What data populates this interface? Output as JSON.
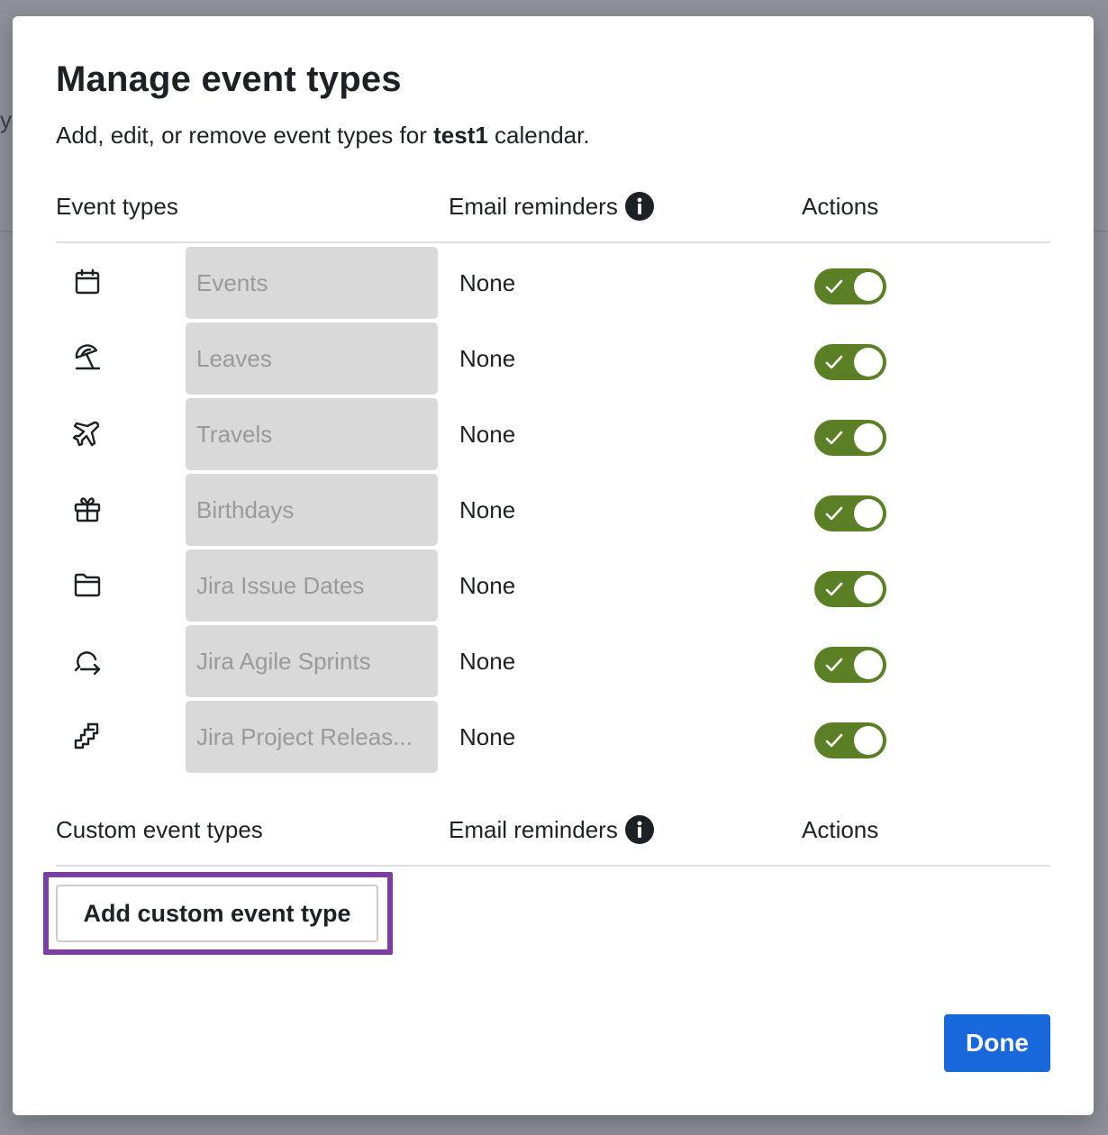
{
  "backdrop": {
    "edge_char": "y"
  },
  "dialog": {
    "title": "Manage event types",
    "subtitle_prefix": "Add, edit, or remove event types for ",
    "calendar_name": "test1",
    "subtitle_suffix": " calendar."
  },
  "builtin_section": {
    "header_types": "Event types",
    "header_reminders": "Email reminders",
    "header_actions": "Actions",
    "rows": [
      {
        "icon": "calendar-icon",
        "name": "Events",
        "reminder": "None",
        "enabled": true
      },
      {
        "icon": "beach-umbrella-icon",
        "name": "Leaves",
        "reminder": "None",
        "enabled": true
      },
      {
        "icon": "airplane-icon",
        "name": "Travels",
        "reminder": "None",
        "enabled": true
      },
      {
        "icon": "gift-icon",
        "name": "Birthdays",
        "reminder": "None",
        "enabled": true
      },
      {
        "icon": "folder-icon",
        "name": "Jira Issue Dates",
        "reminder": "None",
        "enabled": true
      },
      {
        "icon": "sprint-cycle-icon",
        "name": "Jira Agile Sprints",
        "reminder": "None",
        "enabled": true
      },
      {
        "icon": "release-ship-icon",
        "name": "Jira Project Releas...",
        "reminder": "None",
        "enabled": true
      }
    ]
  },
  "custom_section": {
    "header_types": "Custom event types",
    "header_reminders": "Email reminders",
    "header_actions": "Actions",
    "add_button_label": "Add custom event type"
  },
  "footer": {
    "done_label": "Done"
  },
  "colors": {
    "toggle_on": "#5b7f24",
    "primary_button": "#1868db",
    "highlight": "#7a3fa0",
    "field_bg": "#d9d9d9"
  }
}
